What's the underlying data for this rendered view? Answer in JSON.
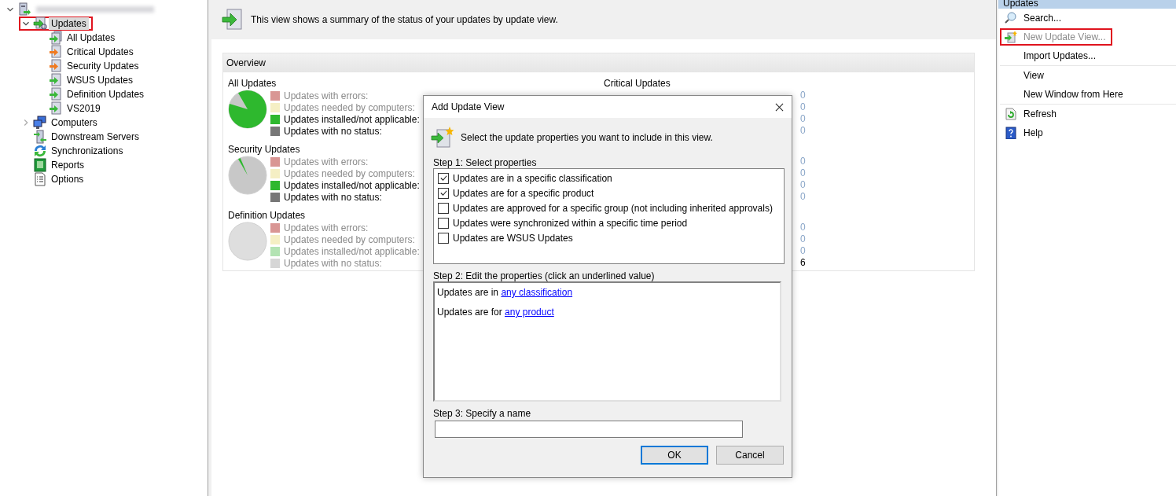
{
  "tree": {
    "expanded": true,
    "children": [
      {
        "label": "Updates",
        "kind": "updates",
        "expanded": true,
        "selected": true,
        "highlighted": true,
        "children": [
          {
            "label": "All Updates",
            "kind": "all-view",
            "selected": false,
            "highlighted": false
          },
          {
            "label": "Critical Updates",
            "kind": "critical-view",
            "selected": false,
            "highlighted": false
          },
          {
            "label": "Security Updates",
            "kind": "critical-view",
            "selected": false,
            "highlighted": false
          },
          {
            "label": "WSUS Updates",
            "kind": "view",
            "selected": false,
            "highlighted": false
          },
          {
            "label": "Definition Updates",
            "kind": "view",
            "selected": false,
            "highlighted": false
          },
          {
            "label": "VS2019",
            "kind": "view",
            "selected": false,
            "highlighted": false
          }
        ]
      },
      {
        "label": "Computers",
        "kind": "computers",
        "expanded": false,
        "selected": false,
        "highlighted": false
      },
      {
        "label": "Downstream Servers",
        "kind": "servers",
        "selected": false,
        "highlighted": false
      },
      {
        "label": "Synchronizations",
        "kind": "sync",
        "selected": false,
        "highlighted": false
      },
      {
        "label": "Reports",
        "kind": "reports",
        "selected": false,
        "highlighted": false
      },
      {
        "label": "Options",
        "kind": "options",
        "selected": false,
        "highlighted": false
      }
    ]
  },
  "banner": {
    "text": "This view shows a summary of the status of your updates by update view."
  },
  "overview": {
    "title": "Overview",
    "left_sections": [
      {
        "title": "All Updates",
        "kind": "mostly-installed",
        "legend": [
          {
            "label": "Updates with errors:",
            "color": "#d99694",
            "active": false
          },
          {
            "label": "Updates needed by computers:",
            "color": "#f5efc4",
            "active": false
          },
          {
            "label": "Updates installed/not applicable:",
            "color": "#2eb82e",
            "active": true
          },
          {
            "label": "Updates with no status:",
            "color": "#777777",
            "active": true
          }
        ]
      },
      {
        "title": "Security Updates",
        "kind": "sliver-installed",
        "legend": [
          {
            "label": "Updates with errors:",
            "color": "#d99694",
            "active": false
          },
          {
            "label": "Updates needed by computers:",
            "color": "#f5efc4",
            "active": false
          },
          {
            "label": "Updates installed/not applicable:",
            "color": "#2eb82e",
            "active": true
          },
          {
            "label": "Updates with no status:",
            "color": "#777777",
            "active": true
          }
        ]
      },
      {
        "title": "Definition Updates",
        "kind": "empty",
        "legend": [
          {
            "label": "Updates with errors:",
            "color": "#d99694",
            "active": false
          },
          {
            "label": "Updates needed by computers:",
            "color": "#f5efc4",
            "active": false
          },
          {
            "label": "Updates installed/not applicable:",
            "color": "#b3e3b3",
            "active": false
          },
          {
            "label": "Updates with no status:",
            "color": "#d6d6d6",
            "active": false
          }
        ]
      }
    ],
    "right_sections": [
      {
        "title": "Critical Updates",
        "counts": [
          {
            "value": "0",
            "active": false
          },
          {
            "value": "0",
            "active": false
          },
          {
            "value": "0",
            "active": false
          },
          {
            "value": "0",
            "active": false
          }
        ]
      },
      {
        "counts": [
          {
            "value": "0",
            "active": false
          },
          {
            "value": "0",
            "active": false
          },
          {
            "value": "0",
            "active": false
          },
          {
            "value": "0",
            "active": false
          }
        ]
      },
      {
        "counts": [
          {
            "value": "0",
            "active": false
          },
          {
            "value": "0",
            "active": false
          },
          {
            "value": "0",
            "active": false
          },
          {
            "value": "6",
            "active": true
          }
        ]
      }
    ]
  },
  "dialog": {
    "title": "Add Update View",
    "intro": "Select the update properties you want to include in this view.",
    "step1": {
      "label": "Step 1: Select properties",
      "options": [
        {
          "label": "Updates are in a specific classification",
          "checked": true
        },
        {
          "label": "Updates are for a specific product",
          "checked": true
        },
        {
          "label": "Updates are approved for a specific group (not including inherited approvals)",
          "checked": false
        },
        {
          "label": "Updates were synchronized within a specific time period",
          "checked": false
        },
        {
          "label": "Updates are WSUS Updates",
          "checked": false
        }
      ]
    },
    "step2": {
      "label": "Step 2: Edit the properties (click an underlined value)",
      "lines": [
        {
          "text": "Updates are in",
          "link": "any classification"
        },
        {
          "text": "Updates are for",
          "link": "any product"
        }
      ]
    },
    "step3": {
      "label": "Step 3: Specify a name"
    },
    "buttons": [
      {
        "label": "OK",
        "default": true
      },
      {
        "label": "Cancel",
        "default": false
      }
    ]
  },
  "actions": {
    "title": "Updates",
    "groups": [
      [
        {
          "label": "Search...",
          "kind": "search",
          "disabled": false,
          "highlighted": false
        },
        {
          "label": "New Update View...",
          "kind": "new-view",
          "disabled": true,
          "highlighted": true
        },
        {
          "label": "Import Updates...",
          "disabled": false,
          "highlighted": false
        }
      ],
      [
        {
          "label": "View",
          "disabled": false,
          "highlighted": false
        },
        {
          "label": "New Window from Here",
          "disabled": false,
          "highlighted": false
        }
      ],
      [
        {
          "label": "Refresh",
          "kind": "refresh",
          "disabled": false,
          "highlighted": false
        },
        {
          "label": "Help",
          "kind": "help",
          "disabled": false,
          "highlighted": false
        }
      ]
    ]
  }
}
